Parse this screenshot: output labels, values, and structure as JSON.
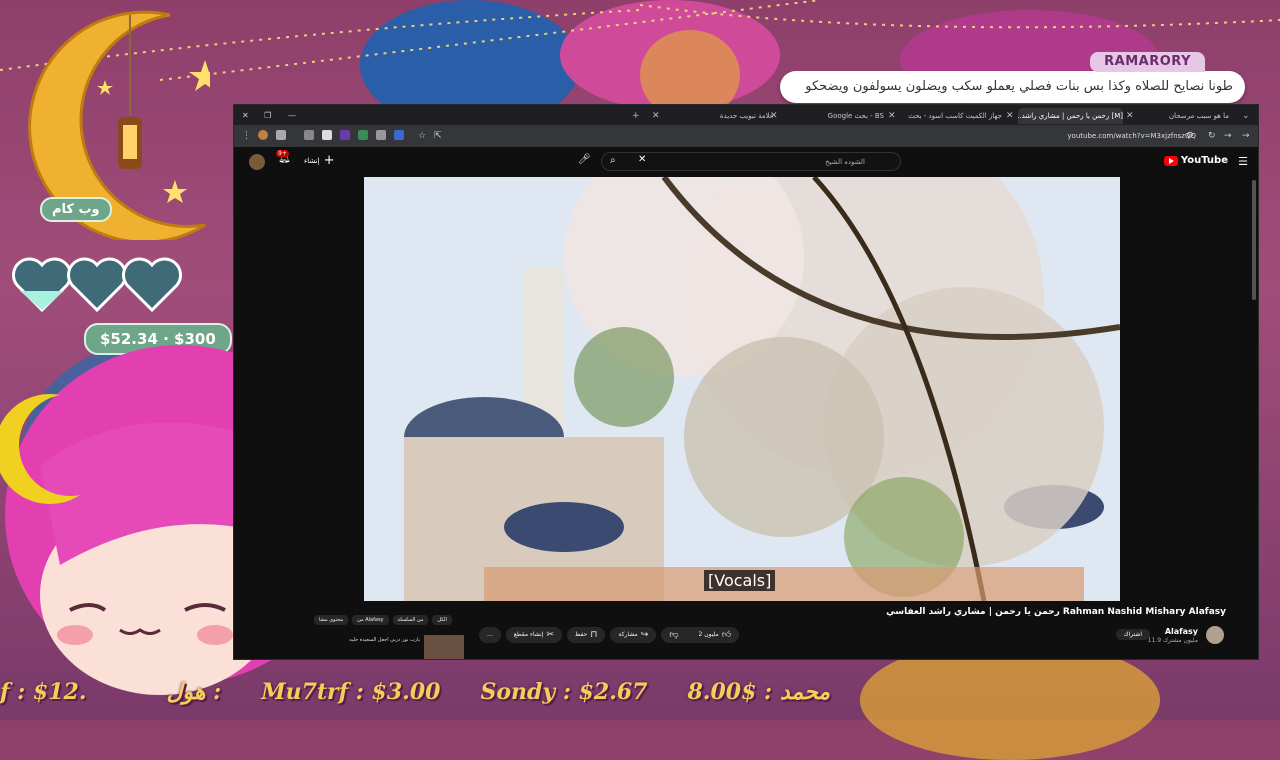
{
  "stream_overlay": {
    "chat_pill": "وب كام",
    "donation_goal": "$52.34 · $300",
    "ticker": [
      "f : $12.",
      "هول : ",
      "Mu7trf : $3.00",
      "Sondy : $2.67",
      "محمد : $8.00"
    ],
    "chat_message": {
      "username": "RAMARORY",
      "text": "طونا نصايح للصلاه وكذا بس بنات فصلي يعملو سكب ويضلون يسولفون ويضحكو"
    }
  },
  "browser": {
    "tabs": [
      {
        "label": "ما هو سبب مرسحان"
      },
      {
        "label": "[M] رحمن يا رحمن | مشاري راشد..."
      },
      {
        "label": "جهاز الكميت كاسب اسود - بحث"
      },
      {
        "label": "BS - بحث Google"
      },
      {
        "label": "علامة تبويب جديدة"
      }
    ],
    "url": "youtube.com/watch?v=M3xjzfnszQQ"
  },
  "youtube": {
    "logo": "YouTube",
    "search_value": "الشوده الشيخ",
    "create_label": "إنشاء",
    "notification_count": "9+",
    "caption": "[Vocals]",
    "video_title": "رحمن يا رحمن | مشاري راشد العفاسي Rahman Nashid Mishary Alafasy",
    "channel_name": "Alafasy",
    "subscribers": "11.9 مليون مشترك",
    "subscribe_label": "اشتراك",
    "actions": {
      "like": "2 مليون",
      "share": "مشاركة",
      "save": "حفظ",
      "clip": "إنشاء مقطع",
      "more": "..."
    },
    "chips": [
      "الكل",
      "من السلسلة",
      "من Alafasy",
      "محتوى مشا"
    ],
    "side_card_title": "يارب نور دربي اجعل السعيدة حليه"
  }
}
